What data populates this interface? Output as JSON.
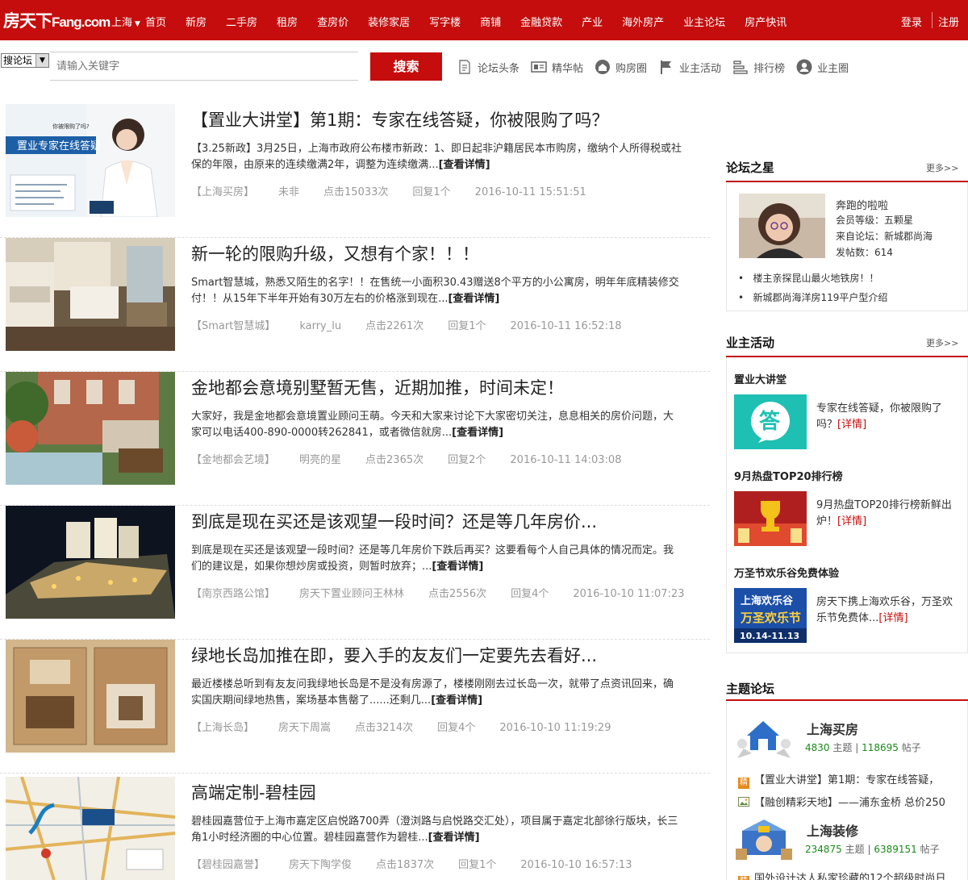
{
  "header": {
    "logo": "房天下",
    "logo_en": "Fang.com",
    "city": "上海",
    "nav": [
      "首页",
      "新房",
      "二手房",
      "租房",
      "查房价",
      "装修家居",
      "写字楼",
      "商铺",
      "金融贷款",
      "产业",
      "海外房产",
      "业主论坛",
      "房产快讯"
    ],
    "login": "登录",
    "register": "注册"
  },
  "search": {
    "scope": "搜论坛",
    "placeholder": "请输入关键字",
    "button": "搜索",
    "links": [
      {
        "label": "论坛头条",
        "icon": "document-icon"
      },
      {
        "label": "精华帖",
        "icon": "news-icon"
      },
      {
        "label": "购房圈",
        "icon": "house-icon"
      },
      {
        "label": "业主活动",
        "icon": "flag-icon"
      },
      {
        "label": "排行榜",
        "icon": "ranking-icon"
      },
      {
        "label": "业主圈",
        "icon": "user-icon"
      }
    ]
  },
  "feed": [
    {
      "title": "【置业大讲堂】第1期：专家在线答疑，你被限购了吗？",
      "desc": "【3.25新政】3月25日，上海市政府公布楼市新政：1、即日起非沪籍居民本市购房，缴纳个人所得税或社保的年限，由原来的连续缴满2年，调整为连续缴满...",
      "more": "[查看详情]",
      "meta": [
        "【上海买房】",
        "未非",
        "点击15033次",
        "回复1个",
        "2016-10-11  15:51:51"
      ]
    },
    {
      "title": "新一轮的限购升级，又想有个家！！！",
      "desc": "Smart智慧城，熟悉又陌生的名字！！在售统一小面积30.43赠送8个平方的小公寓房，明年年底精装修交付！！从15年下半年开始有30万左右的价格涨到现在...",
      "more": "[查看详情]",
      "meta": [
        "【Smart智慧城】",
        "karry_lu",
        "点击2261次",
        "回复1个",
        "2016-10-11  16:52:18"
      ]
    },
    {
      "title": "金地都会意境别墅暂无售，近期加推，时间未定！",
      "desc": "大家好，我是金地都会意境置业顾问王萌。今天和大家来讨论下大家密切关注，息息相关的房价问题，大家可以电话400-890-0000转262841，或者微信就房...",
      "more": "[查看详情]",
      "meta": [
        "【金地都会艺境】",
        "明亮的星",
        "点击2365次",
        "回复2个",
        "2016-10-11  14:03:08"
      ]
    },
    {
      "title": "到底是现在买还是该观望一段时间？还是等几年房价...",
      "desc": "到底是现在买还是该观望一段时间？还是等几年房价下跌后再买？这要看每个人自己具体的情况而定。我们的建议是，如果你想炒房或投资，则暂时放弃；...",
      "more": "[查看详情]",
      "meta": [
        "【南京西路公馆】",
        "房天下置业顾问王林林",
        "点击2556次",
        "回复4个",
        "2016-10-10  11:07:23"
      ]
    },
    {
      "title": "绿地长岛加推在即，要入手的友友们一定要先去看好...",
      "desc": "最近楼楼总听到有友友问我绿地长岛是不是没有房源了，楼楼刚刚去过长岛一次，就带了点资讯回来，确实国庆期间绿地热售，案场基本售罄了......还剩几...",
      "more": "[查看详情]",
      "meta": [
        "【上海长岛】",
        "房天下周嵩",
        "点击3214次",
        "回复4个",
        "2016-10-10  11:19:29"
      ]
    },
    {
      "title": "高端定制-碧桂园",
      "desc": "碧桂园嘉营位于上海市嘉定区启悦路700弄（澄浏路与启悦路交汇处），项目属于嘉定北部徐行版块，长三角1小时经济圈的中心位置。碧桂园嘉营作为碧桂...",
      "more": "[查看详情]",
      "meta": [
        "【碧桂园嘉誉】",
        "房天下陶学俊",
        "点击1837次",
        "回复1个",
        "2016-10-10  16:57:13"
      ]
    }
  ],
  "sidebar": {
    "star": {
      "heading": "论坛之星",
      "more": "更多>>",
      "name": "奔跑的啦啦",
      "level": "会员等级：五颗星",
      "from": "来自论坛：新城郡尚海",
      "posts": "发帖数：614",
      "links": [
        "楼主亲探昆山最火地铁房！！",
        "新城郡尚海洋房119平户型介绍"
      ]
    },
    "activity": {
      "heading": "业主活动",
      "more": "更多>>",
      "items": [
        {
          "title": "置业大讲堂",
          "text": "专家在线答疑，你被限购了吗？",
          "detail": "[详情]"
        },
        {
          "title": "9月热盘TOP20排行榜",
          "text": "9月热盘TOP20排行榜新鲜出炉！",
          "detail": "[详情]"
        },
        {
          "title": "万圣节欢乐谷免费体验",
          "text": "房天下携上海欢乐谷，万圣欢乐节免费体...",
          "detail": "[详情]"
        }
      ]
    },
    "forums": {
      "heading": "主题论坛",
      "items": [
        {
          "name": "上海买房",
          "topics": "4830",
          "topics_unit": "主题",
          "posts": "118695",
          "posts_unit": "帖子",
          "posts_list": [
            "【置业大讲堂】第1期：专家在线答疑，",
            "【融创精彩天地】——浦东金桥 总价250"
          ]
        },
        {
          "name": "上海装修",
          "topics": "234875",
          "topics_unit": "主题",
          "posts": "6389151",
          "posts_unit": "帖子",
          "posts_list": [
            "国外设计达人私家珍藏的12个超级时尚日"
          ]
        }
      ]
    }
  },
  "colors": {
    "brand": "#c50d0d",
    "stat_green": "#1a8a1a"
  }
}
